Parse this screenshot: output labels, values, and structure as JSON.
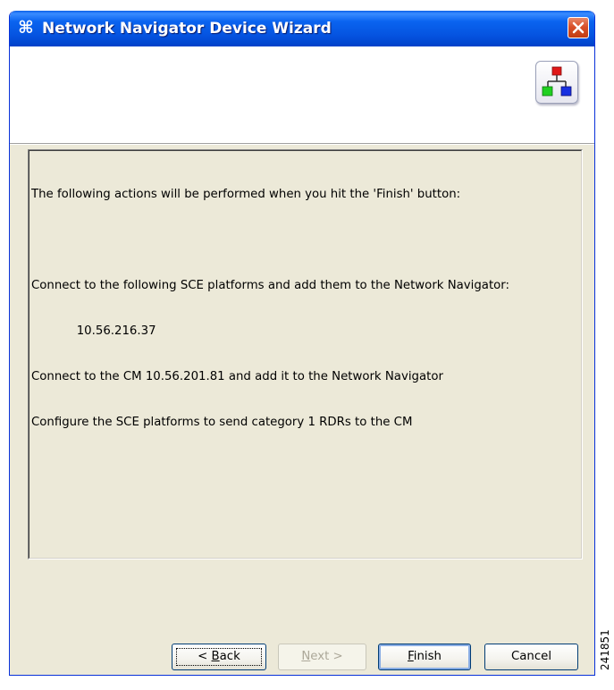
{
  "window": {
    "title": "Network Navigator Device Wizard",
    "close_icon": "close-icon",
    "title_icon": "wizard-app-icon",
    "header_graphic_icon": "network-hierarchy-icon"
  },
  "summary": {
    "lines": [
      "The following actions will be performed when you hit the 'Finish' button:",
      "",
      "Connect to the following SCE platforms and add them to the Network Navigator:",
      "            10.56.216.37",
      "Connect to the CM 10.56.201.81 and add it to the Network Navigator",
      "Configure the SCE platforms to send category 1 RDRs to the CM"
    ]
  },
  "buttons": {
    "back": {
      "prefix": "< ",
      "mnemonic": "B",
      "rest": "ack"
    },
    "next": {
      "mnemonic": "N",
      "rest": "ext >"
    },
    "finish": {
      "mnemonic": "F",
      "rest": "inish"
    },
    "cancel": {
      "label": "Cancel"
    }
  },
  "figure_id": "241851",
  "colors": {
    "titlebar": "#0553e0",
    "dialog_bg": "#ece9d8",
    "close_button": "#d9512a",
    "disabled_text": "#aca899"
  }
}
